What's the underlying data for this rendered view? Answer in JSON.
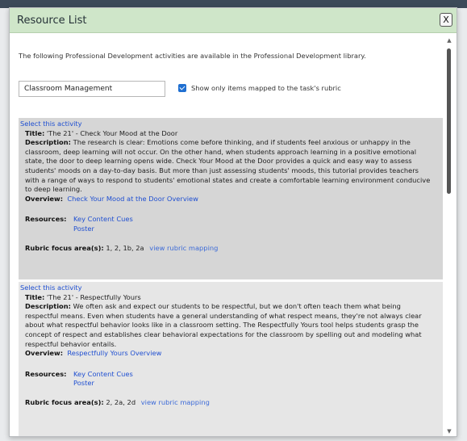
{
  "dialog": {
    "title": "Resource List",
    "close_label": "X"
  },
  "intro": "The following Professional Development activities are available in the Professional Development library.",
  "filter": {
    "value": "Classroom Management",
    "checkbox_checked": true,
    "checkbox_label": "Show only items mapped to the task's rubric"
  },
  "activities": [
    {
      "select_label": "Select this activity",
      "title_label": "Title:",
      "title": "'The 21' - Check Your Mood at the Door",
      "description_label": "Description:",
      "description": "The research is clear: Emotions come before thinking, and if students feel anxious or unhappy in the classroom, deep learning will not occur. On the other hand, when students approach learning in a positive emotional state, the door to deep learning opens wide. Check Your Mood at the Door provides a quick and easy way to assess students' moods on a day-to-day basis. But more than just assessing students' moods, this tutorial provides teachers with a range of ways to respond to students' emotional states and create a comfortable learning environment conducive to deep learning.",
      "overview_label": "Overview:",
      "overview_link": "Check Your Mood at the Door Overview",
      "resources_label": "Resources:",
      "resources": [
        "Key Content Cues",
        "Poster"
      ],
      "rubric_label": "Rubric focus area(s):",
      "rubric_areas": "1, 2, 1b, 2a",
      "rubric_link": "view rubric mapping"
    },
    {
      "select_label": "Select this activity",
      "title_label": "Title:",
      "title": "'The 21' - Respectfully Yours",
      "description_label": "Description:",
      "description": "We often ask and expect our students to be respectful, but we don't often teach them what being respectful means. Even when students have a general understanding of what respect means, they're not always clear about what respectful behavior looks like in a classroom setting. The Respectfully Yours tool helps students grasp the concept of respect and establishes clear behavioral expectations for the classroom by spelling out and modeling what respectful behavior entails.",
      "overview_label": "Overview:",
      "overview_link": "Respectfully Yours Overview",
      "resources_label": "Resources:",
      "resources": [
        "Key Content Cues",
        "Poster"
      ],
      "rubric_label": "Rubric focus area(s):",
      "rubric_areas": "2, 2a, 2d",
      "rubric_link": "view rubric mapping"
    }
  ],
  "scrollbar": {
    "up_icon": "chevron-up-icon",
    "down_icon": "chevron-down-icon"
  },
  "colors": {
    "title_bar": "#cfe6c9",
    "activity_selected_bg": "#d6d6d6",
    "activity_bg": "#e6e6e6",
    "link": "#1f4fd1",
    "checkbox": "#1f6fd1"
  }
}
